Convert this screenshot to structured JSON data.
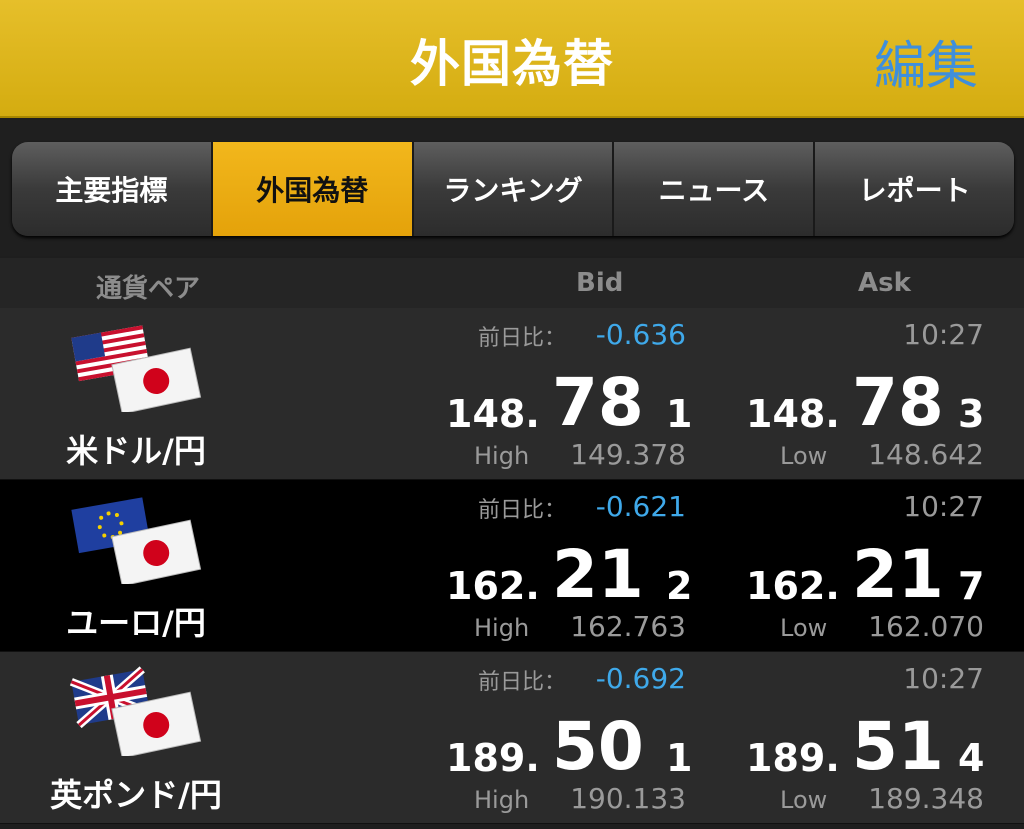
{
  "header": {
    "title": "外国為替",
    "edit_label": "編集"
  },
  "tabs": [
    {
      "label": "主要指標",
      "active": false
    },
    {
      "label": "外国為替",
      "active": true
    },
    {
      "label": "ランキング",
      "active": false
    },
    {
      "label": "ニュース",
      "active": false
    },
    {
      "label": "レポート",
      "active": false
    }
  ],
  "columns": {
    "pair": "通貨ペア",
    "bid": "Bid",
    "ask": "Ask"
  },
  "rows": [
    {
      "pair": "米ドル/円",
      "flags": "us-jp-flags-icon",
      "change_label": "前日比：",
      "change": "-0.636",
      "time": "10:27",
      "bid": {
        "pre": "148.",
        "big": "78",
        "last": "1"
      },
      "ask": {
        "pre": "148.",
        "big": "78",
        "last": "3"
      },
      "high_label": "High",
      "high": "149.378",
      "low_label": "Low",
      "low": "148.642"
    },
    {
      "pair": "ユーロ/円",
      "flags": "eu-jp-flags-icon",
      "change_label": "前日比：",
      "change": "-0.621",
      "time": "10:27",
      "bid": {
        "pre": "162.",
        "big": "21",
        "last": "2"
      },
      "ask": {
        "pre": "162.",
        "big": "21",
        "last": "7"
      },
      "high_label": "High",
      "high": "162.763",
      "low_label": "Low",
      "low": "162.070"
    },
    {
      "pair": "英ポンド/円",
      "flags": "uk-jp-flags-icon",
      "change_label": "前日比：",
      "change": "-0.692",
      "time": "10:27",
      "bid": {
        "pre": "189.",
        "big": "50",
        "last": "1"
      },
      "ask": {
        "pre": "189.",
        "big": "51",
        "last": "4"
      },
      "high_label": "High",
      "high": "190.133",
      "low_label": "Low",
      "low": "189.348"
    }
  ],
  "colors": {
    "header": "#d9b21a",
    "accent_tab": "#eaa80f",
    "edit_link": "#3f8fdc",
    "change_value": "#3fa9ea"
  }
}
